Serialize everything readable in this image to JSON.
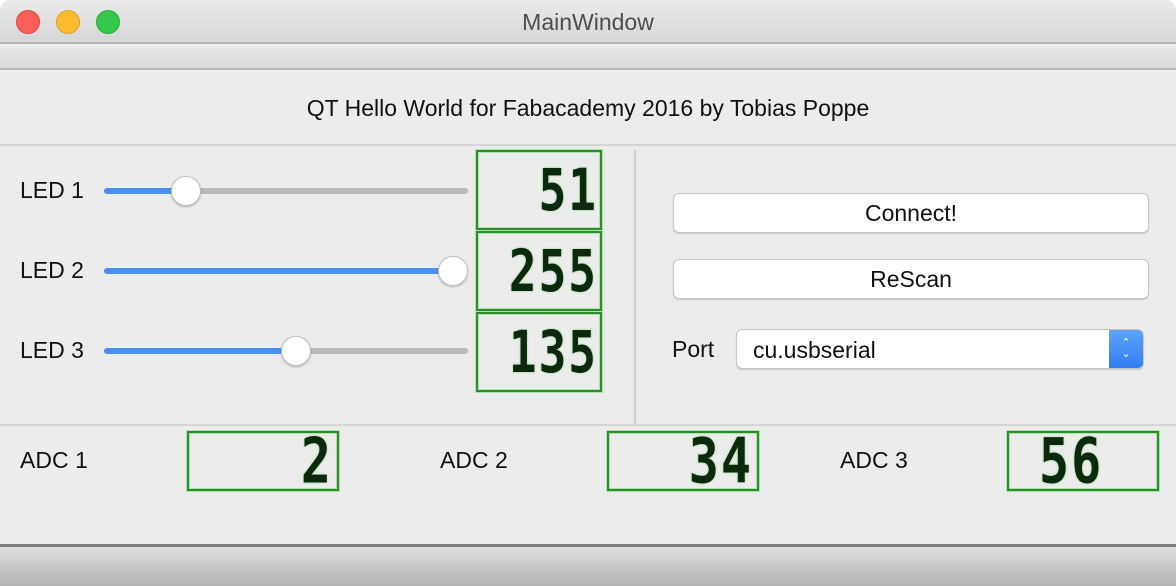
{
  "window": {
    "title": "MainWindow",
    "controls": [
      "close",
      "minimize",
      "maximize"
    ]
  },
  "heading": "QT Hello World for Fabacademy 2016 by Tobias Poppe",
  "leds": [
    {
      "label": "LED 1",
      "value": 51,
      "display": "51",
      "slider_max": 255
    },
    {
      "label": "LED 2",
      "value": 255,
      "display": "255",
      "slider_max": 255
    },
    {
      "label": "LED 3",
      "value": 135,
      "display": "135",
      "slider_max": 255
    }
  ],
  "connection": {
    "connect_label": "Connect!",
    "rescan_label": "ReScan",
    "port_label": "Port",
    "port_value": "cu.usbserial"
  },
  "adcs": [
    {
      "label": "ADC 1",
      "display": "2"
    },
    {
      "label": "ADC 2",
      "display": "34"
    },
    {
      "label": "ADC 3",
      "display": "56"
    }
  ],
  "colors": {
    "slider_fill": "#4a90f0",
    "lcd_border": "#2e8b2e",
    "close": "#fc5f57",
    "minimize": "#fdbc2e",
    "maximize": "#34c84a"
  }
}
